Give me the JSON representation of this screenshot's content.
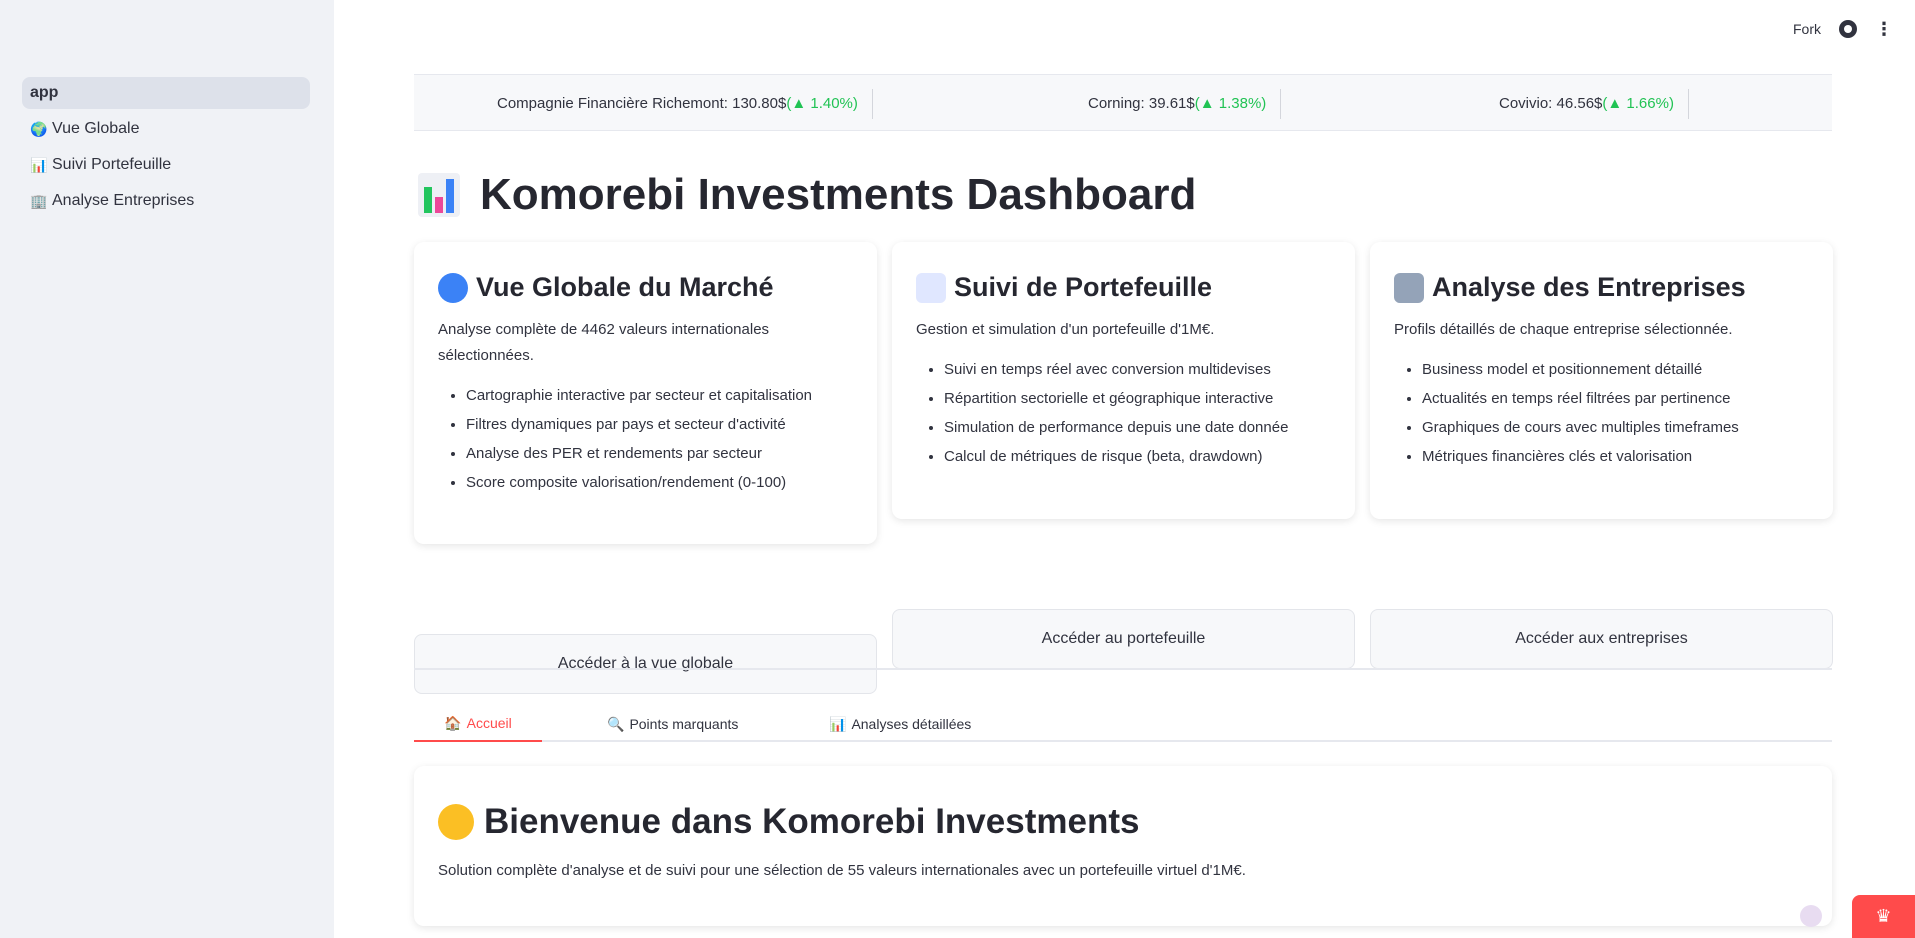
{
  "sidebar": {
    "items": [
      {
        "icon": "",
        "label": "app"
      },
      {
        "icon": "globe-icon",
        "label": "Vue Globale"
      },
      {
        "icon": "bar-chart-icon",
        "label": "Suivi Portefeuille"
      },
      {
        "icon": "office-building-icon",
        "label": "Analyse Entreprises"
      }
    ]
  },
  "header": {
    "fork_label": "Fork"
  },
  "ticker": [
    {
      "text": "Compagnie Financière Richemont: 130.80$ ",
      "change": "(▲ 1.40%)"
    },
    {
      "text": "Corning: 39.61$ ",
      "change": "(▲ 1.38%)"
    },
    {
      "text": "Covivio: 46.56$ ",
      "change": "(▲ 1.66%)"
    }
  ],
  "page_title": "Komorebi Investments Dashboard",
  "cards": [
    {
      "title": "Vue Globale du Marché",
      "desc": "Analyse complète de 4462 valeurs internationales sélectionnées.",
      "bullets": [
        "Cartographie interactive par secteur et capitalisation",
        "Filtres dynamiques par pays et secteur d'activité",
        "Analyse des PER et rendements par secteur",
        "Score composite valorisation/rendement (0-100)"
      ],
      "button": "Accéder à la vue globale"
    },
    {
      "title": "Suivi de Portefeuille",
      "desc": "Gestion et simulation d'un portefeuille d'1M€.",
      "bullets": [
        "Suivi en temps réel avec conversion multidevises",
        "Répartition sectorielle et géographique interactive",
        "Simulation de performance depuis une date donnée",
        "Calcul de métriques de risque (beta, drawdown)"
      ],
      "button": "Accéder au portefeuille"
    },
    {
      "title": "Analyse des Entreprises",
      "desc": "Profils détaillés de chaque entreprise sélectionnée.",
      "bullets": [
        "Business model et positionnement détaillé",
        "Actualités en temps réel filtrées par pertinence",
        "Graphiques de cours avec multiples timeframes",
        "Métriques financières clés et valorisation"
      ],
      "button": "Accéder aux entreprises"
    }
  ],
  "tabs": [
    {
      "icon": "house-icon",
      "label": "Accueil"
    },
    {
      "icon": "magnifier-icon",
      "label": "Points marquants"
    },
    {
      "icon": "bar-chart-icon",
      "label": "Analyses détaillées"
    }
  ],
  "welcome": {
    "title": "Bienvenue dans Komorebi Investments",
    "text": "Solution complète d'analyse et de suivi pour une sélection de 55 valeurs internationales avec un portefeuille virtuel d'1M€."
  },
  "colors": {
    "accent": "#ff4b4b",
    "positive": "#21c354",
    "sidebar_bg": "#f0f2f6"
  }
}
